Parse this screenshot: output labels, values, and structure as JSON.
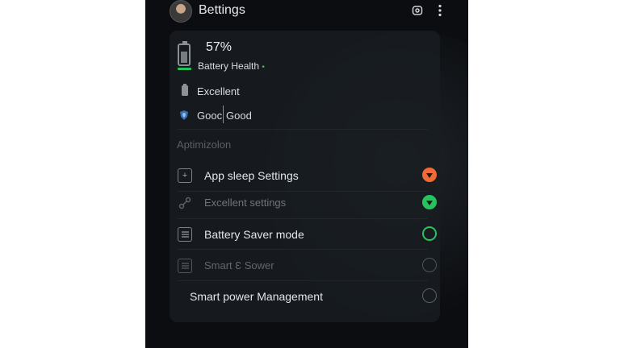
{
  "header": {
    "title": "Bettings"
  },
  "battery": {
    "percent": "57%",
    "health_label": "Battery Health",
    "health_indicator": "•",
    "level_fraction": 0.57
  },
  "status": {
    "condition": "Excellent",
    "signal_left": "Gooc",
    "signal_right": "Good"
  },
  "section_title": "Aptimizolon",
  "options": [
    {
      "label": "App sleep Settings",
      "icon": "plus-square-icon",
      "state": "orange",
      "color": "#f06a35"
    },
    {
      "label": "Excellent settings",
      "icon": "link-icon",
      "state": "green",
      "color": "#27c35e"
    },
    {
      "label": "Battery Saver mode",
      "icon": "list-icon",
      "state": "outline-green",
      "color": "#27c35e"
    },
    {
      "label": "Smart Ɛ Sower",
      "icon": "list-icon",
      "state": "outline-gray",
      "color": "#62676c"
    },
    {
      "label": "Smart power Management",
      "icon": "none",
      "state": "outline-gray",
      "color": "#6a6f74"
    }
  ]
}
